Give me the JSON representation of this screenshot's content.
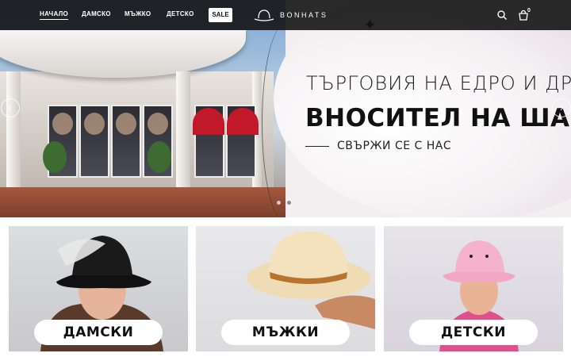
{
  "nav": {
    "links": [
      "НАЧАЛО",
      "ДАМСКО",
      "МЪЖКО",
      "ДЕТСКО"
    ],
    "sale": "SALE",
    "logo": "BONHATS",
    "cart_count": "0"
  },
  "hero": {
    "headline1": "ТЪРГОВИЯ НА ЕДРО И ДРЕБНО",
    "headline2": "ВНОСИТЕЛ НА ШАПКИ",
    "contact": "СВЪРЖИ СЕ С НАС",
    "prev_icon": "chevron-left-icon",
    "next_icon": "chevron-right-icon",
    "slides_total": 2,
    "slide_active": 2
  },
  "categories": [
    {
      "label": "ДАМСКИ"
    },
    {
      "label": "МЪЖКИ"
    },
    {
      "label": "ДЕТСКИ"
    }
  ],
  "icons": {
    "search": "search-icon",
    "cart": "shopping-bag-icon",
    "logo": "hat-logo-icon"
  },
  "colors": {
    "nav_bg": "#141414",
    "awning_red": "#c2192a"
  }
}
